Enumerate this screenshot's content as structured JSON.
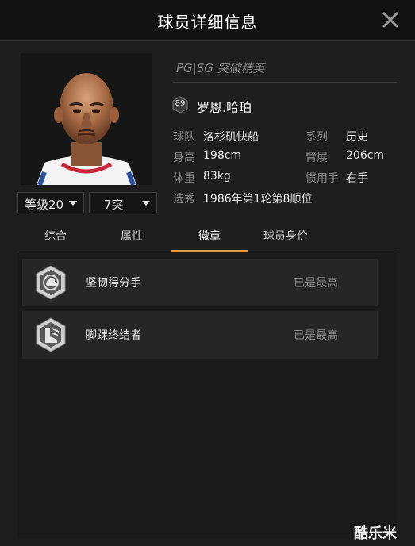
{
  "header": {
    "title": "球员详细信息",
    "close_icon": "close-icon"
  },
  "player": {
    "type": "PG|SG 突破精英",
    "rating": "89",
    "name": "罗恩.哈珀",
    "level_select": "等级20",
    "break_select": "7突",
    "info": [
      {
        "label": "球队",
        "value": "洛杉矶快船"
      },
      {
        "label": "系列",
        "value": "历史"
      },
      {
        "label": "身高",
        "value": "198cm"
      },
      {
        "label": "臂展",
        "value": "206cm"
      },
      {
        "label": "体重",
        "value": "83kg"
      },
      {
        "label": "惯用手",
        "value": "右手"
      },
      {
        "label": "选秀",
        "value": "1986年第1轮第8顺位"
      }
    ]
  },
  "tabs": [
    {
      "label": "综合"
    },
    {
      "label": "属性"
    },
    {
      "label": "徽章"
    },
    {
      "label": "球员身价"
    }
  ],
  "active_tab": "徽章",
  "badges": [
    {
      "name": "坚韧得分手",
      "status": "已是最高",
      "icon": "flexed-arm-badge-icon"
    },
    {
      "name": "脚踝终结者",
      "status": "已是最高",
      "icon": "ankle-breaker-badge-icon"
    }
  ],
  "watermark": "酷乐米",
  "colors": {
    "accent": "#d1a24a",
    "background": "#1e1e1e",
    "header": "#121212"
  }
}
